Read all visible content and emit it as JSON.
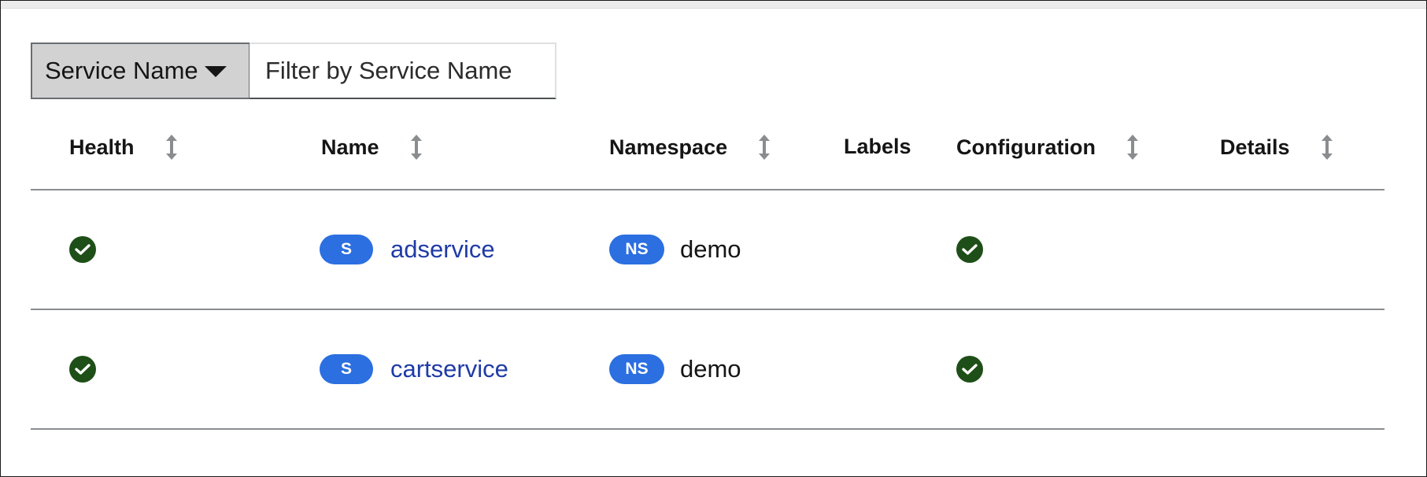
{
  "filter": {
    "type_label": "Service Name",
    "placeholder": "Filter by Service Name",
    "value": ""
  },
  "columns": {
    "health": "Health",
    "name": "Name",
    "namespace": "Namespace",
    "labels": "Labels",
    "configuration": "Configuration",
    "details": "Details"
  },
  "rows": [
    {
      "health": "healthy",
      "service_badge": "S",
      "service_name": "adservice",
      "namespace_badge": "NS",
      "namespace": "demo",
      "labels": "",
      "configuration": "valid",
      "details": ""
    },
    {
      "health": "healthy",
      "service_badge": "S",
      "service_name": "cartservice",
      "namespace_badge": "NS",
      "namespace": "demo",
      "labels": "",
      "configuration": "valid",
      "details": ""
    }
  ],
  "colors": {
    "badge": "#2b6fe0",
    "link": "#1f3ba6",
    "ok": "#1e4f18"
  },
  "icons": {
    "sort": "sort-icon",
    "health": "check-circle-icon",
    "dropdown": "caret-down-icon"
  }
}
